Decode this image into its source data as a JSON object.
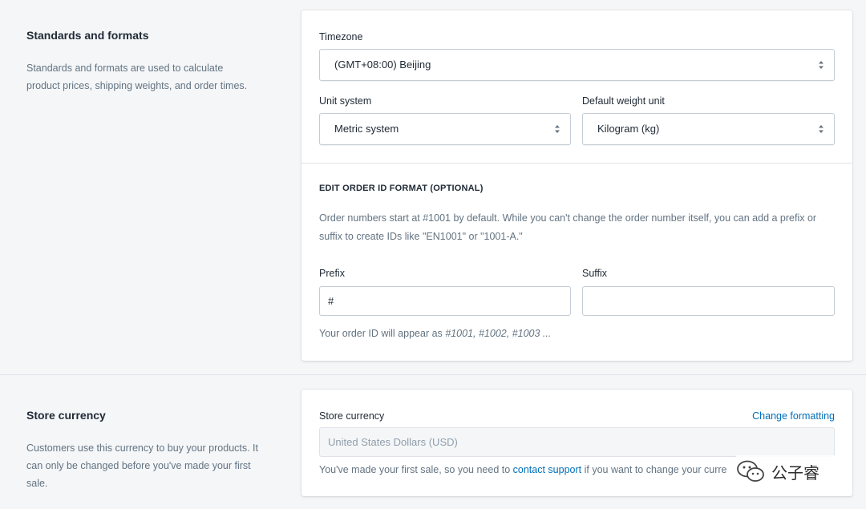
{
  "standards": {
    "title": "Standards and formats",
    "description": "Standards and formats are used to calculate product prices, shipping weights, and order times.",
    "timezone": {
      "label": "Timezone",
      "value": "(GMT+08:00) Beijing"
    },
    "unit_system": {
      "label": "Unit system",
      "value": "Metric system"
    },
    "weight_unit": {
      "label": "Default weight unit",
      "value": "Kilogram (kg)"
    },
    "order_id": {
      "heading": "EDIT ORDER ID FORMAT (OPTIONAL)",
      "help": "Order numbers start at #1001 by default. While you can't change the order number itself, you can add a prefix or suffix to create IDs like \"EN1001\" or \"1001-A.\"",
      "prefix_label": "Prefix",
      "prefix_value": "#",
      "suffix_label": "Suffix",
      "suffix_value": "",
      "preview_text": "Your order ID will appear as ",
      "preview_values": "#1001, #1002, #1003 ..."
    }
  },
  "currency": {
    "title": "Store currency",
    "description": "Customers use this currency to buy your products. It can only be changed before you've made your first sale.",
    "field_label": "Store currency",
    "change_link": "Change formatting",
    "value": "United States Dollars (USD)",
    "notice_before": "You've made your first sale, so you need to ",
    "notice_link": "contact support",
    "notice_after": " if you want to change your curre"
  },
  "watermark": {
    "text": "公子睿",
    "icon": "wechat-icon"
  }
}
